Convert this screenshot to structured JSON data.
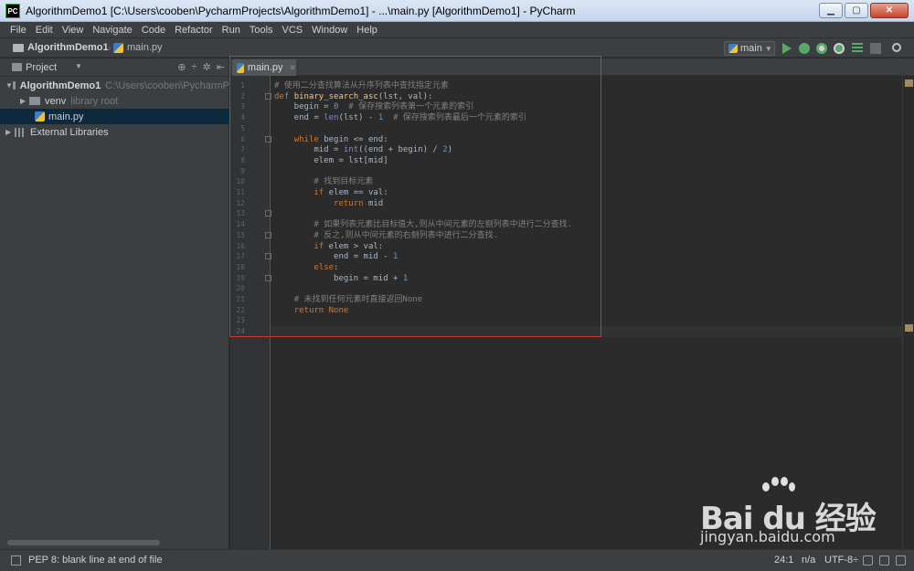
{
  "window": {
    "title": "AlgorithmDemo1 [C:\\Users\\cooben\\PycharmProjects\\AlgorithmDemo1] - ...\\main.py [AlgorithmDemo1] - PyCharm",
    "app_icon": "PC",
    "minimize": "▁",
    "maximize": "▢",
    "close": "✕"
  },
  "menu": [
    "File",
    "Edit",
    "View",
    "Navigate",
    "Code",
    "Refactor",
    "Run",
    "Tools",
    "VCS",
    "Window",
    "Help"
  ],
  "navbar": {
    "project": "AlgorithmDemo1",
    "file": "main.py",
    "run_config": "main"
  },
  "project_panel": {
    "title": "Project",
    "tree": [
      {
        "label": "AlgorithmDemo1",
        "hint": "C:\\Users\\cooben\\PycharmP",
        "arrow": "▼"
      },
      {
        "label": "venv",
        "hint": "library root",
        "arrow": "▶"
      },
      {
        "label": "main.py",
        "hint": ""
      },
      {
        "label": "External Libraries",
        "hint": "",
        "arrow": "▶"
      }
    ]
  },
  "editor": {
    "tab": "main.py",
    "lines": [
      [
        [
          "t-cm",
          "# 使用二分查找算法从升序列表中查找指定元素"
        ]
      ],
      [
        [
          "t-kw",
          "def "
        ],
        [
          "t-fn",
          "binary_search_asc"
        ],
        [
          "t-id",
          "(lst, val):"
        ]
      ],
      [
        [
          "t-id",
          "    begin = "
        ],
        [
          "t-num",
          "0"
        ],
        [
          "t-id",
          "  "
        ],
        [
          "t-cm",
          "# 保存搜索列表第一个元素的索引"
        ]
      ],
      [
        [
          "t-id",
          "    end = "
        ],
        [
          "t-bi",
          "len"
        ],
        [
          "t-id",
          "(lst) - "
        ],
        [
          "t-num",
          "1"
        ],
        [
          "t-id",
          "  "
        ],
        [
          "t-cm",
          "# 保存搜索列表最后一个元素的索引"
        ]
      ],
      [],
      [
        [
          "t-id",
          "    "
        ],
        [
          "t-kw",
          "while "
        ],
        [
          "t-id",
          "begin <= end:"
        ]
      ],
      [
        [
          "t-id",
          "        mid = "
        ],
        [
          "t-bi",
          "int"
        ],
        [
          "t-id",
          "((end + begin) / "
        ],
        [
          "t-num",
          "2"
        ],
        [
          "t-id",
          ")"
        ]
      ],
      [
        [
          "t-id",
          "        elem = lst[mid]"
        ]
      ],
      [],
      [
        [
          "t-id",
          "        "
        ],
        [
          "t-cm",
          "# 找到目标元素"
        ]
      ],
      [
        [
          "t-id",
          "        "
        ],
        [
          "t-kw",
          "if "
        ],
        [
          "t-id",
          "elem == val:"
        ]
      ],
      [
        [
          "t-id",
          "            "
        ],
        [
          "t-kw",
          "return "
        ],
        [
          "t-id",
          "mid"
        ]
      ],
      [],
      [
        [
          "t-id",
          "        "
        ],
        [
          "t-cm",
          "# 如果列表元素比目标值大,则从中间元素的左侧列表中进行二分查找."
        ]
      ],
      [
        [
          "t-id",
          "        "
        ],
        [
          "t-cm",
          "# 反之,则从中间元素的右侧列表中进行二分查找."
        ]
      ],
      [
        [
          "t-id",
          "        "
        ],
        [
          "t-kw",
          "if "
        ],
        [
          "t-id",
          "elem > val:"
        ]
      ],
      [
        [
          "t-id",
          "            end = mid - "
        ],
        [
          "t-num",
          "1"
        ]
      ],
      [
        [
          "t-id",
          "        "
        ],
        [
          "t-kw",
          "else"
        ],
        [
          "t-id",
          ":"
        ]
      ],
      [
        [
          "t-id",
          "            begin = mid + "
        ],
        [
          "t-num",
          "1"
        ]
      ],
      [],
      [
        [
          "t-id",
          "    "
        ],
        [
          "t-cm",
          "# 未找到任何元素时直接返回None"
        ]
      ],
      [
        [
          "t-id",
          "    "
        ],
        [
          "t-kw",
          "return None"
        ]
      ],
      [],
      []
    ]
  },
  "status": {
    "message": "PEP 8: blank line at end of file",
    "position": "24:1",
    "line_sep": "n/a",
    "encoding": "UTF-8÷"
  },
  "watermark": {
    "brand": "Bai du 经验",
    "url": "jingyan.baidu.com"
  }
}
